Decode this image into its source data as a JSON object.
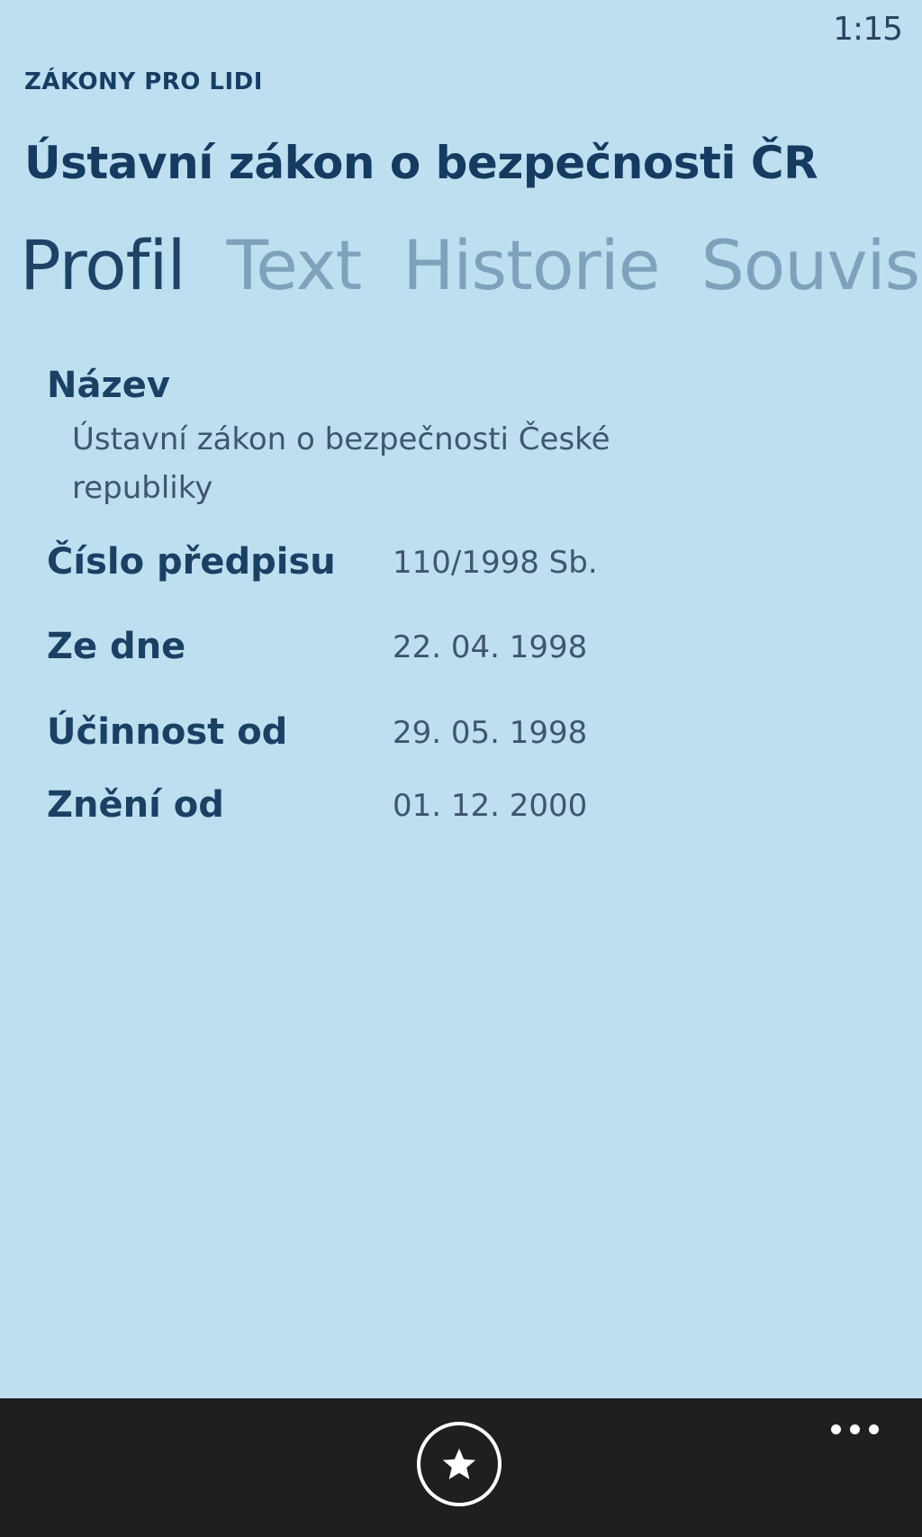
{
  "status_bar": {
    "time": "1:15"
  },
  "header": {
    "app_name": "ZÁKONY PRO LIDI",
    "title": "Ústavní zákon o bezpečnosti ČR"
  },
  "pivot": {
    "tabs": [
      {
        "label": "Profil",
        "active": true
      },
      {
        "label": "Text",
        "active": false
      },
      {
        "label": "Historie",
        "active": false
      },
      {
        "label": "Souvis",
        "active": false
      }
    ]
  },
  "profile": {
    "name_label": "Název",
    "name_value": "Ústavní zákon o bezpečnosti České republiky",
    "fields": [
      {
        "label": "Číslo předpisu",
        "value": "110/1998 Sb."
      },
      {
        "label": "Ze dne",
        "value": "22. 04. 1998"
      },
      {
        "label": "Účinnost od",
        "value": "29. 05. 1998"
      },
      {
        "label": "Znění od",
        "value": "01. 12. 2000"
      }
    ]
  },
  "app_bar": {
    "favorite_icon": "star-icon",
    "more_icon": "more-icon",
    "background_color": "#1f1f1f"
  },
  "colors": {
    "background": "#bddff0",
    "accent_text": "#173e62",
    "inactive_tab": "#7ea1bc"
  }
}
